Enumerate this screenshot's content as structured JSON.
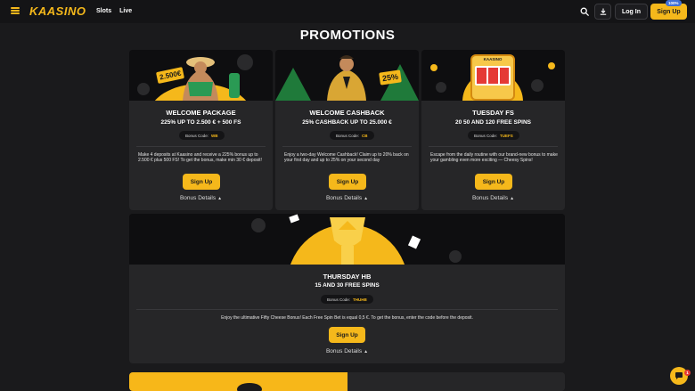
{
  "header": {
    "logo_text": "KAASINO",
    "nav": [
      "Slots",
      "Live"
    ],
    "login_label": "Log In",
    "signup_label": "Sign Up",
    "bonus_badge": "100%"
  },
  "page": {
    "title": "PROMOTIONS"
  },
  "promotions": [
    {
      "title": "WELCOME PACKAGE",
      "subtitle": "225% UP TO 2.500 € + 500 FS",
      "code_label": "Bonus Code:",
      "code": "WB",
      "badge": "2.500€",
      "description": "Make 4 deposits at Kaasino and receive a 225% bonus up to 2.500 € plus 500 FS! To get the bonus, make min 30 € deposit!",
      "cta": "Sign Up",
      "details": "Bonus Details"
    },
    {
      "title": "WELCOME CASHBACK",
      "subtitle": "25% CASHBACK UP TO 25.000 €",
      "code_label": "Bonus Code:",
      "code": "CB",
      "badge": "25%",
      "description": "Enjoy a two-day Welcome Cashback! Claim up to 20% back on your first day and up to 25% on your second day",
      "cta": "Sign Up",
      "details": "Bonus Details"
    },
    {
      "title": "TUESDAY FS",
      "subtitle": "20 50 AND 120 FREE SPINS",
      "code_label": "Bonus Code:",
      "code": "TUEFS",
      "badge": "KAASINO",
      "description": "Escape from the daily routine with our brand-new bonus to make your gambling even more exciting — Cheesy Spins!",
      "cta": "Sign Up",
      "details": "Bonus Details"
    },
    {
      "title": "THURSDAY HB",
      "subtitle": "15 AND 30 FREE SPINS",
      "code_label": "Bonus Code:",
      "code": "THUHB",
      "description": "Enjoy the ultimative Fifty Cheese Bonus! Each Free Spin Bet is equal 0,5 €. To get the bonus, enter the code before the deposit.",
      "cta": "Sign Up",
      "details": "Bonus Details"
    }
  ],
  "chat": {
    "unread": "1"
  },
  "colors": {
    "accent": "#f5b81b",
    "background": "#1a1a1c",
    "card": "#262628",
    "header": "#141416"
  }
}
